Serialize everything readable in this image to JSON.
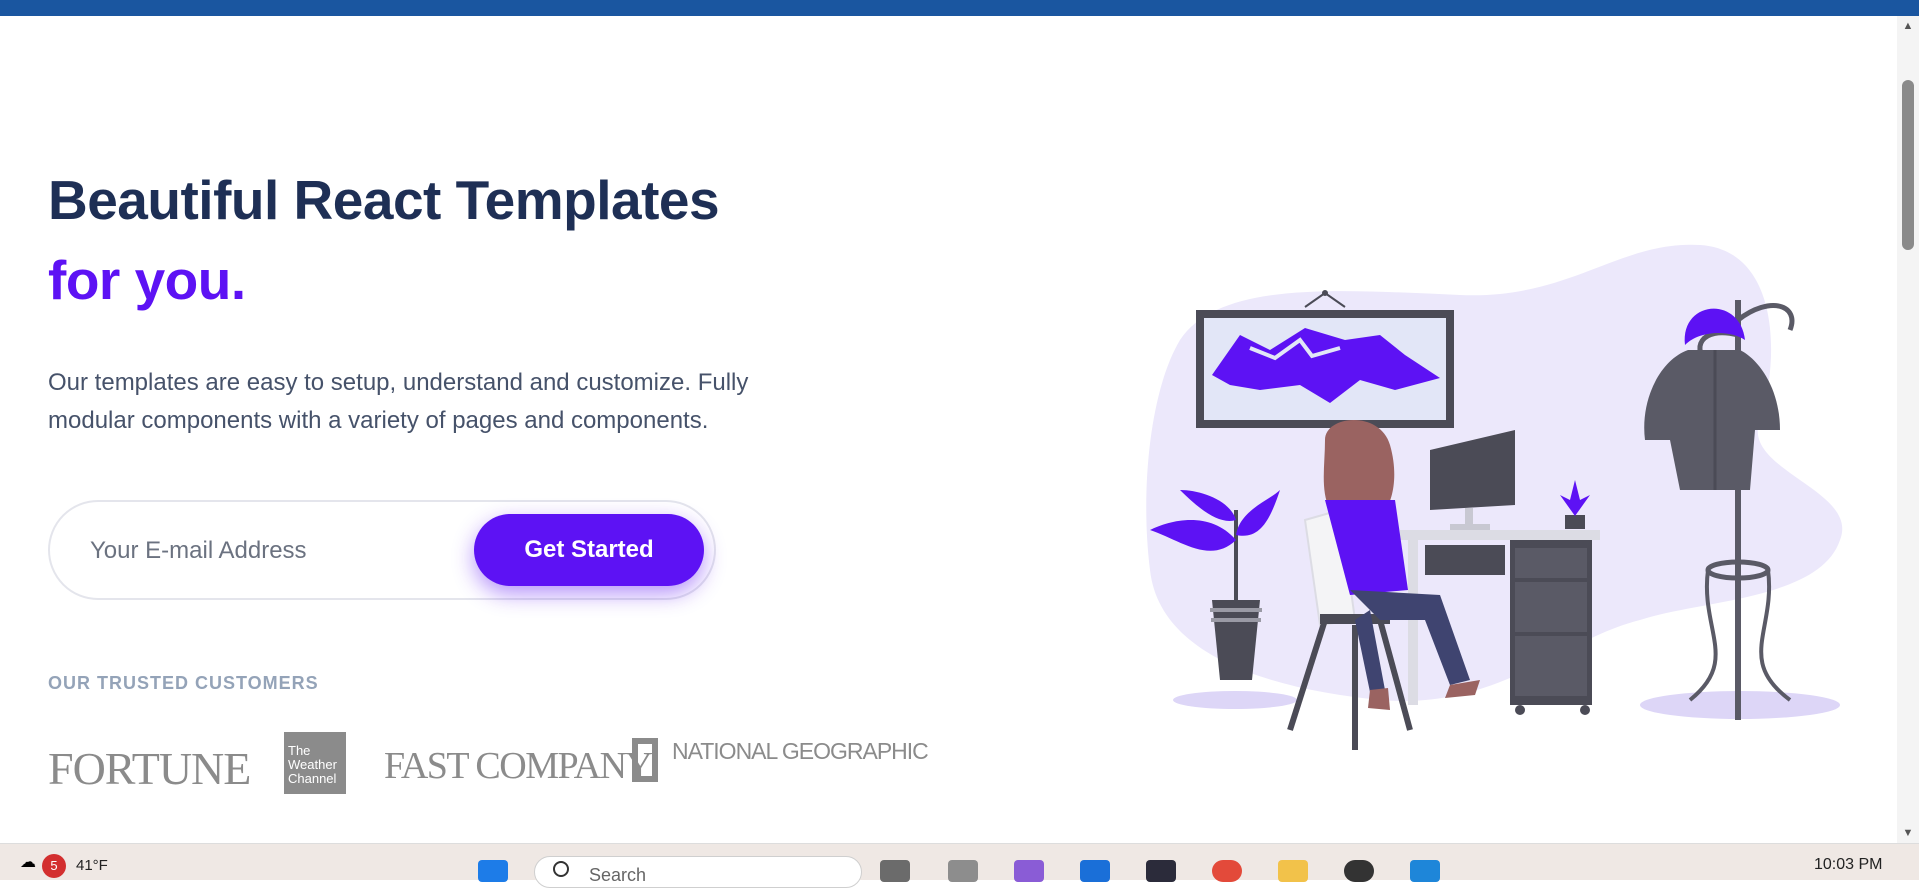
{
  "hero": {
    "title_line1": "Beautiful React Templates",
    "title_line2": "for you.",
    "subtitle": "Our templates are easy to setup, understand and customize. Fully modular components with a variety of pages and components."
  },
  "signup": {
    "email_placeholder": "Your E-mail Address",
    "button_label": "Get Started"
  },
  "customers": {
    "heading": "OUR TRUSTED CUSTOMERS",
    "logos": [
      "FORTUNE",
      "The Weather Channel",
      "FAST COMPANY",
      "NATIONAL GEOGRAPHIC"
    ]
  },
  "colors": {
    "accent": "#5d12f4",
    "heading": "#1e2f55",
    "body_text": "#46526a",
    "topbar": "#1a56a0"
  },
  "taskbar": {
    "notification_count": "5",
    "temperature": "41°F",
    "search_label": "Search",
    "time": "10:03 PM",
    "apps": [
      "windows-start-icon",
      "task-view-icon",
      "devtools-icon",
      "visual-studio-icon",
      "outlook-icon",
      "terminal-icon",
      "chrome-icon",
      "file-explorer-icon",
      "chatgpt-icon",
      "vscode-icon"
    ]
  },
  "illustration": {
    "description_icon": "person-at-desk-illustration-icon"
  }
}
